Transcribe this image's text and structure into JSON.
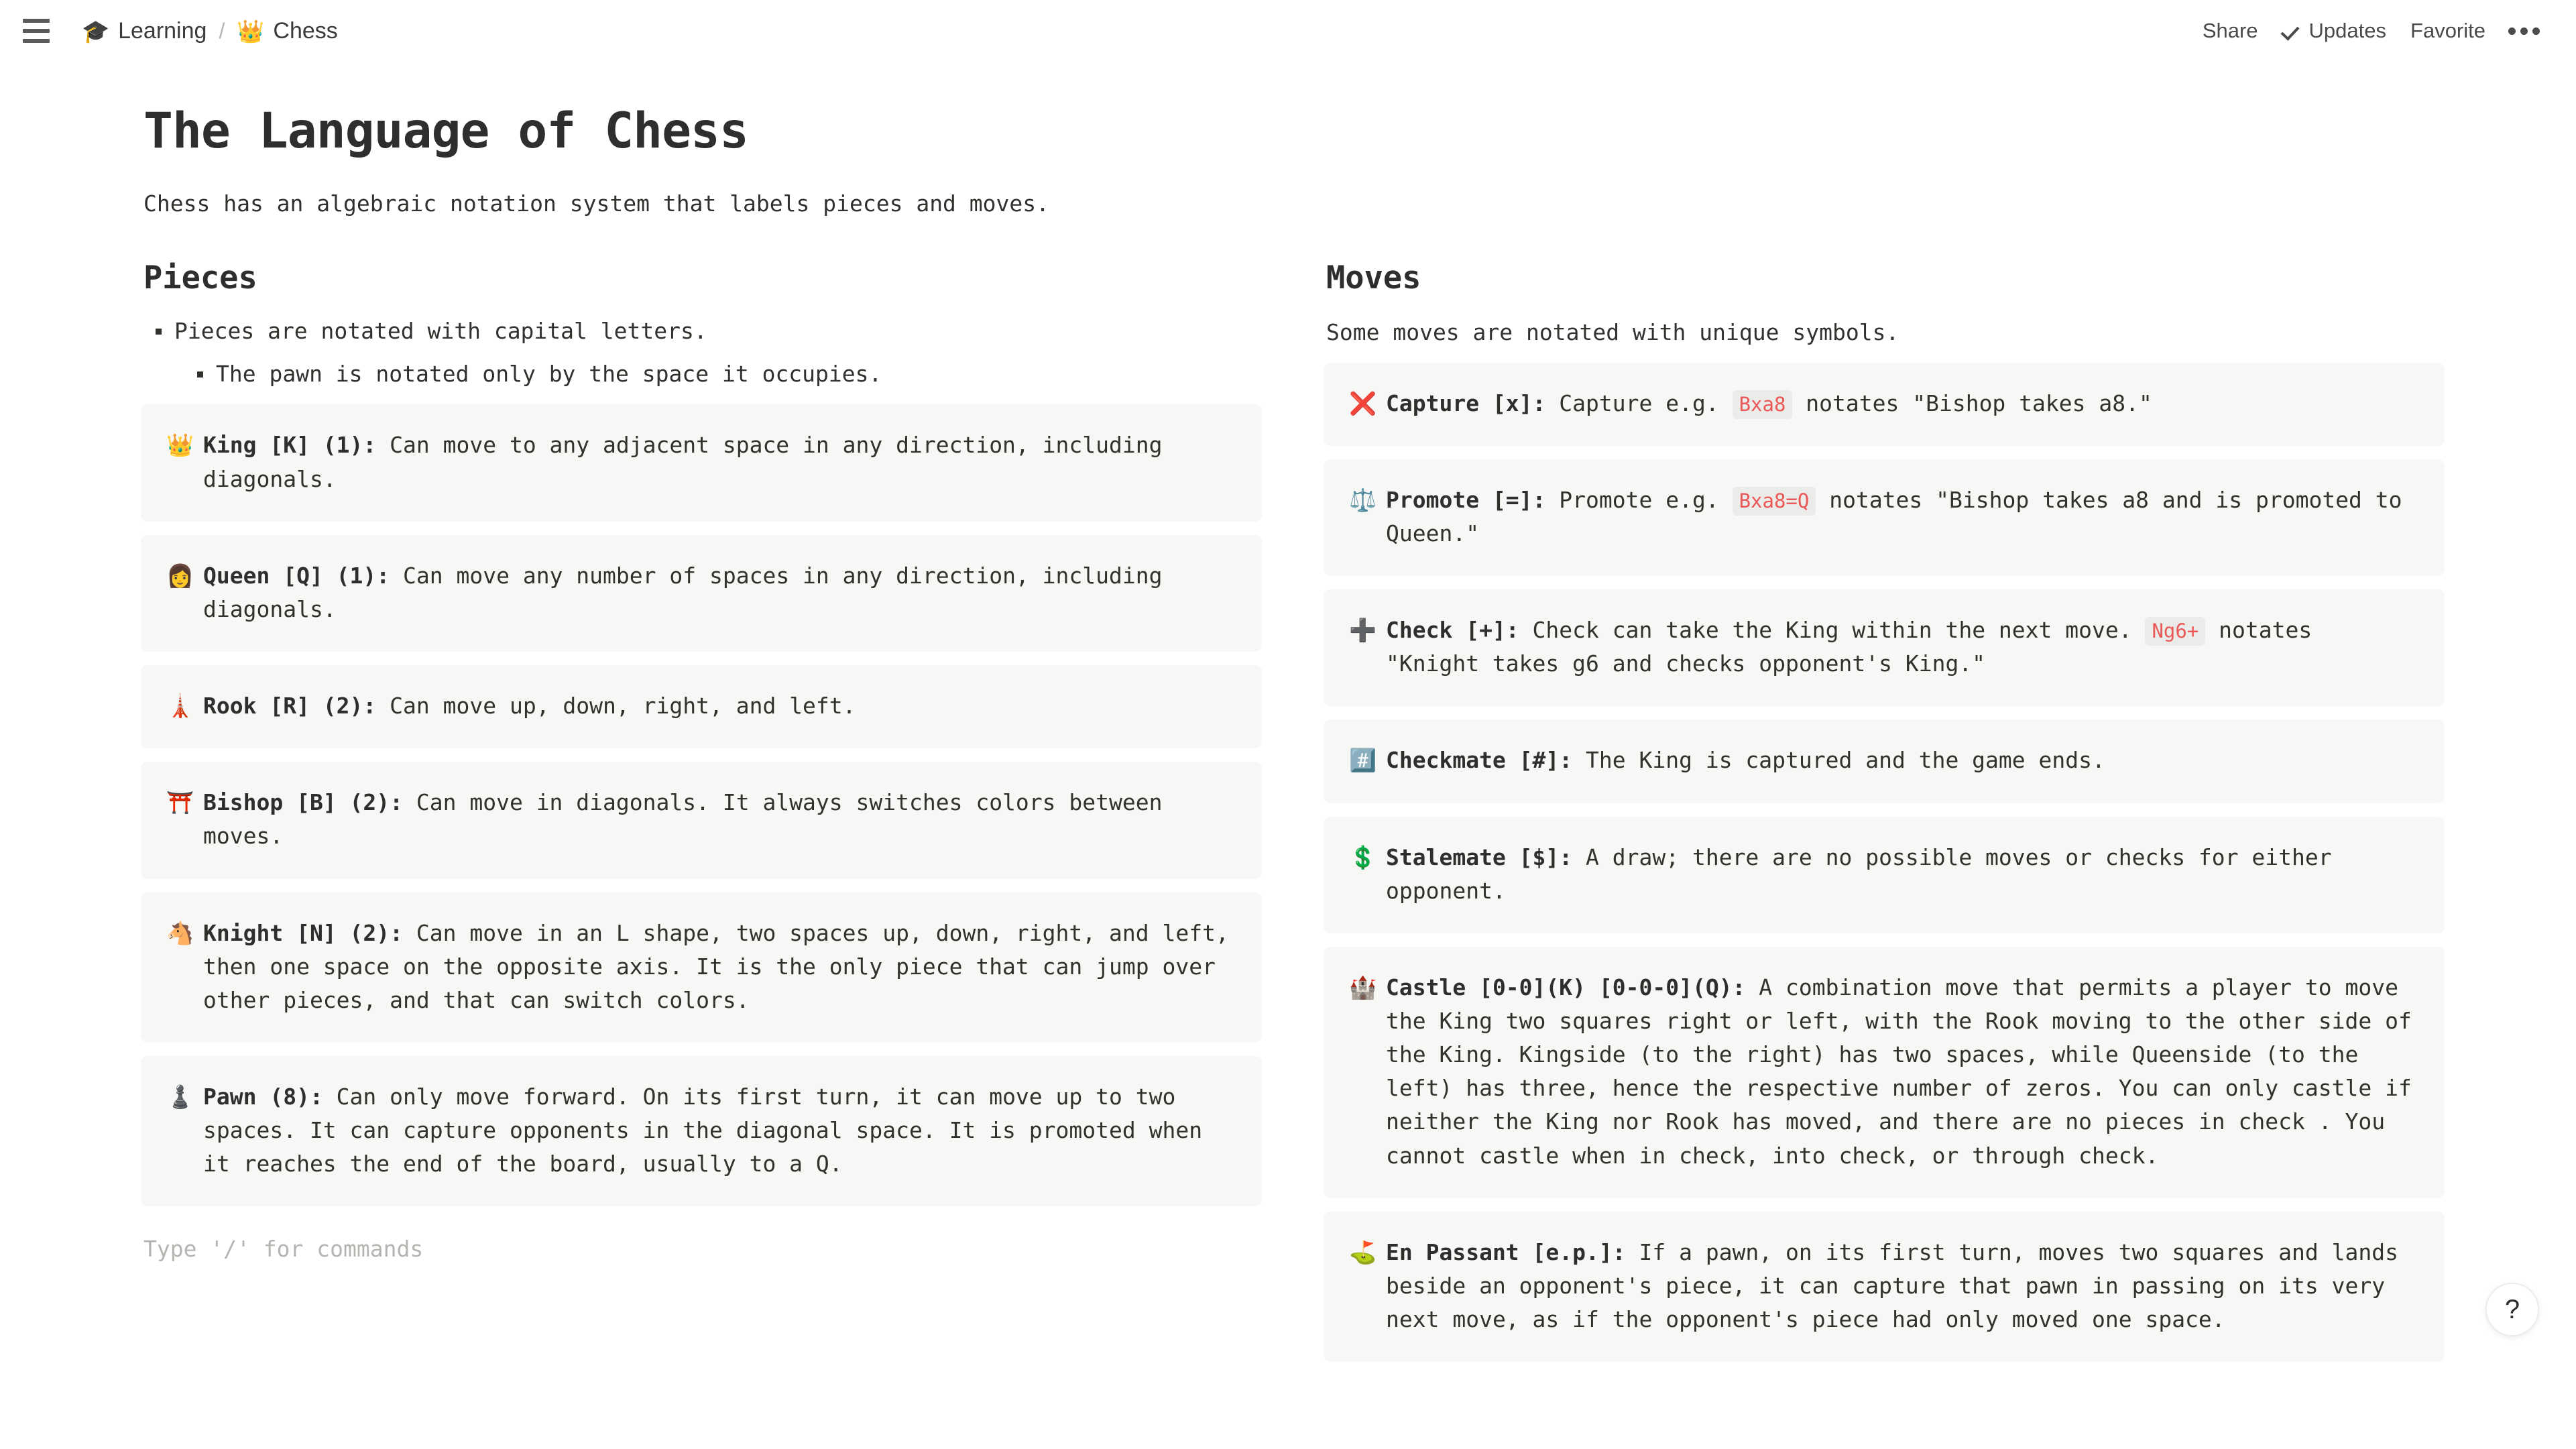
{
  "topbar": {
    "menu_icon": "hamburger-icon",
    "breadcrumb": [
      {
        "emoji": "🎓",
        "label": "Learning"
      },
      {
        "emoji": "👑",
        "label": "Chess"
      }
    ],
    "separator": "/",
    "actions": {
      "share": "Share",
      "updates": "Updates",
      "favorite": "Favorite",
      "more": "more-options-icon"
    }
  },
  "doc": {
    "title": "The Language of Chess",
    "subtitle": "Chess has an algebraic notation system that labels pieces and moves.",
    "placeholder": "Type '/' for commands"
  },
  "pieces": {
    "heading": "Pieces",
    "bullets": [
      "Pieces are notated with capital letters.",
      "The pawn is notated only by the space it occupies."
    ],
    "items": [
      {
        "emoji": "👑",
        "icon_name": "crown-icon",
        "title": "King [K] (1):",
        "body": "Can move to any adjacent space in any direction, including diagonals."
      },
      {
        "emoji": "👩",
        "icon_name": "woman-icon",
        "title": "Queen [Q] (1):",
        "body": "Can move any number of spaces in any direction, including diagonals."
      },
      {
        "emoji": "🗼",
        "icon_name": "tokyo-tower-icon",
        "title": "Rook [R] (2):",
        "body": "Can move up, down, right, and left."
      },
      {
        "emoji": "⛩️",
        "icon_name": "shinto-shrine-icon",
        "title": "Bishop [B] (2):",
        "body": "Can move in diagonals. It always switches colors between moves."
      },
      {
        "emoji": "🐴",
        "icon_name": "horse-face-icon",
        "title": "Knight [N] (2):",
        "body": "Can move in an L shape, two spaces up, down, right, and left, then one space on the opposite axis. It is the only piece that can jump over other pieces, and that can switch colors."
      },
      {
        "emoji": "♟️",
        "icon_name": "chess-pawn-icon",
        "title": "Pawn (8):",
        "body": "Can only move forward. On its first turn, it can move up to two spaces. It can capture opponents in the diagonal space. It is promoted when it reaches the end of the board, usually to a Q."
      }
    ]
  },
  "moves": {
    "heading": "Moves",
    "subtitle": "Some moves are notated with unique symbols.",
    "items": [
      {
        "emoji": "❌",
        "icon_name": "cross-mark-icon",
        "title": "Capture [x]:",
        "body_before": "Capture e.g. ",
        "code": "Bxa8",
        "body_after": " notates \"Bishop takes a8.\""
      },
      {
        "emoji": "⚖️",
        "icon_name": "balance-scale-icon",
        "title": "Promote [=]:",
        "body_before": "Promote e.g. ",
        "code": "Bxa8=Q",
        "body_after": " notates \"Bishop takes a8 and is promoted to Queen.\""
      },
      {
        "emoji": "➕",
        "icon_name": "plus-sign-icon",
        "title": "Check [+]:",
        "body_before": "Check can take the King within the next move. ",
        "code": "Ng6+",
        "body_after": " notates \"Knight takes g6 and checks opponent's King.\""
      },
      {
        "emoji": "#️⃣",
        "icon_name": "hash-keycap-icon",
        "title": "Checkmate [#]:",
        "body_before": "The King is captured and the game ends.",
        "code": "",
        "body_after": ""
      },
      {
        "emoji": "💲",
        "icon_name": "dollar-sign-icon",
        "title": "Stalemate [$]:",
        "body_before": "A draw; there are no possible moves or checks for either opponent.",
        "code": "",
        "body_after": ""
      },
      {
        "emoji": "🏰",
        "icon_name": "castle-icon",
        "title": "Castle [0-0](K) [0-0-0](Q):",
        "body_before": "A combination move that permits a player to move the King two squares right or left, with the Rook moving to the other side of the King. Kingside (to the right) has two spaces, while Queenside (to the left) has three, hence the respective number of zeros. You can only castle if neither the King nor Rook has moved, and there are no pieces in check . You cannot castle when in check, into check, or through check.",
        "code": "",
        "body_after": ""
      },
      {
        "emoji": "⛳",
        "icon_name": "flag-in-hole-icon",
        "title": "En Passant [e.p.]:",
        "body_before": "If a pawn, on its first turn, moves two squares and lands beside an opponent's piece, it can capture that pawn in passing on its very next move, as if the opponent's piece had only moved one space.",
        "code": "",
        "body_after": ""
      }
    ]
  },
  "help": {
    "label": "?"
  },
  "colors": {
    "callout_bg": "#f7f7f5",
    "code_bg": "#ebebe9",
    "code_fg": "#eb5757",
    "text": "#33312e",
    "placeholder": "#b4b4b0"
  }
}
